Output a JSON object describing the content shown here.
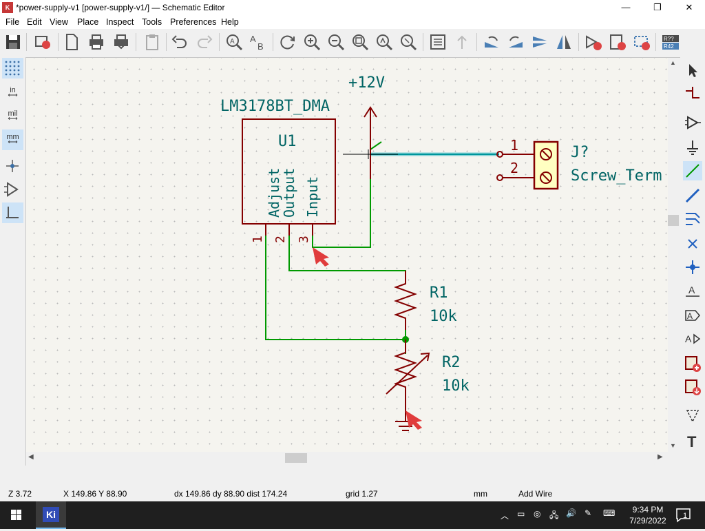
{
  "window": {
    "title": "*power-supply-v1 [power-supply-v1/] — Schematic Editor",
    "minimize_icon": "minimize-icon",
    "maximize_icon": "restore-icon",
    "close_icon": "close-icon"
  },
  "menu": [
    "File",
    "Edit",
    "View",
    "Place",
    "Inspect",
    "Tools",
    "Preferences",
    "Help"
  ],
  "left_toolbar": {
    "units_in": "in",
    "units_mil": "mil",
    "units_mm": "mm"
  },
  "schematic": {
    "regulator_value": "LM3178BT_DMA",
    "regulator_ref": "U1",
    "pin_names": [
      "Adjust",
      "Output",
      "Input"
    ],
    "pin_numbers": [
      "1",
      "2",
      "3"
    ],
    "power_label": "+12V",
    "r1_ref": "R1",
    "r1_value": "10k",
    "r2_ref": "R2",
    "r2_value": "10k",
    "conn_ref": "J?",
    "conn_value": "Screw_Term",
    "conn_pin1": "1",
    "conn_pin2": "2"
  },
  "status": {
    "zoom": "Z 3.72",
    "coords": "X 149.86  Y 88.90",
    "delta": "dx 149.86  dy 88.90  dist 174.24",
    "grid": "grid 1.27",
    "units": "mm",
    "tool": "Add Wire"
  },
  "taskbar": {
    "app_label": "Ki",
    "time": "9:34 PM",
    "date": "7/29/2022",
    "notification_count": "1"
  },
  "colors": {
    "symbol_body": "#840000",
    "wire": "#009900",
    "text": "#006464",
    "highlight_wire": "#4fb0b4",
    "marker": "#e03c3c"
  }
}
